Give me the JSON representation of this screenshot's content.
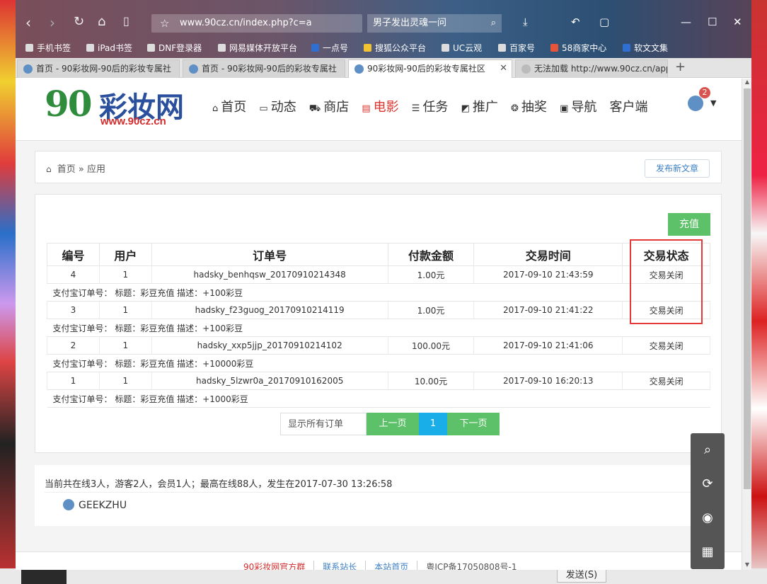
{
  "browser": {
    "url": "www.90cz.cn/index.php?c=a",
    "search_text": "男子发出灵魂一问",
    "bookmarks": [
      "手机书签",
      "iPad书签",
      "DNF登录器",
      "网易媒体开放平台",
      "一点号",
      "搜狐公众平台",
      "UC云观",
      "百家号",
      "58商家中心",
      "软文文集"
    ],
    "tabs": [
      {
        "title": "首页 - 90彩妆网-90后的彩妆专属社"
      },
      {
        "title": "首页 - 90彩妆网-90后的彩妆专属社"
      },
      {
        "title": "90彩妆网-90后的彩妆专属社区"
      },
      {
        "title": "无法加载 http://www.90cz.cn/app"
      }
    ]
  },
  "site": {
    "logo_number": "90",
    "logo_text": "彩妆网",
    "logo_url": "www.90cz.cn",
    "nav": [
      "首页",
      "动态",
      "商店",
      "电影",
      "任务",
      "推广",
      "抽奖",
      "导航",
      "客户端"
    ],
    "notification_count": "2"
  },
  "breadcrumb": {
    "home": "首页",
    "sep": "»",
    "current": "应用"
  },
  "buttons": {
    "new_article": "发布新文章",
    "recharge": "充值"
  },
  "table": {
    "headers": [
      "编号",
      "用户",
      "订单号",
      "付款金额",
      "交易时间",
      "交易状态"
    ],
    "detail_prefix": "支付宝订单号：",
    "rows": [
      {
        "id": "4",
        "user": "1",
        "order_no": "hadsky_benhqsw_20170910214348",
        "amount": "1.00元",
        "time": "2017-09-10 21:43:59",
        "status": "交易关闭",
        "detail": "标题：彩豆充值   描述：+100彩豆"
      },
      {
        "id": "3",
        "user": "1",
        "order_no": "hadsky_f23guog_20170910214119",
        "amount": "1.00元",
        "time": "2017-09-10 21:41:22",
        "status": "交易关闭",
        "detail": "标题：彩豆充值   描述：+100彩豆"
      },
      {
        "id": "2",
        "user": "1",
        "order_no": "hadsky_xxp5jjp_20170910214102",
        "amount": "100.00元",
        "time": "2017-09-10 21:41:06",
        "status": "交易关闭",
        "detail": "标题：彩豆充值   描述：+10000彩豆"
      },
      {
        "id": "1",
        "user": "1",
        "order_no": "hadsky_5lzwr0a_20170910162005",
        "amount": "10.00元",
        "time": "2017-09-10 16:20:13",
        "status": "交易关闭",
        "detail": "标题：彩豆充值   描述：+1000彩豆"
      }
    ]
  },
  "pager": {
    "show_all": "显示所有订单",
    "prev": "上一页",
    "current": "1",
    "next": "下一页"
  },
  "online": {
    "summary": "当前共在线3人，游客2人，会员1人；最高在线88人，发生在2017-07-30 13:26:58",
    "member": "GEEKZHU"
  },
  "footer": {
    "links": [
      "90彩妆网官方群",
      "联系站长",
      "本站首页"
    ],
    "icp": "粤ICP备17050808号-1"
  },
  "desktop": {
    "send_button": "发送(S)"
  },
  "colors": {
    "accent_green": "#5cc168",
    "accent_blue": "#1aaee8",
    "highlight_red": "#e53935",
    "brand_red": "#d42c2c"
  }
}
